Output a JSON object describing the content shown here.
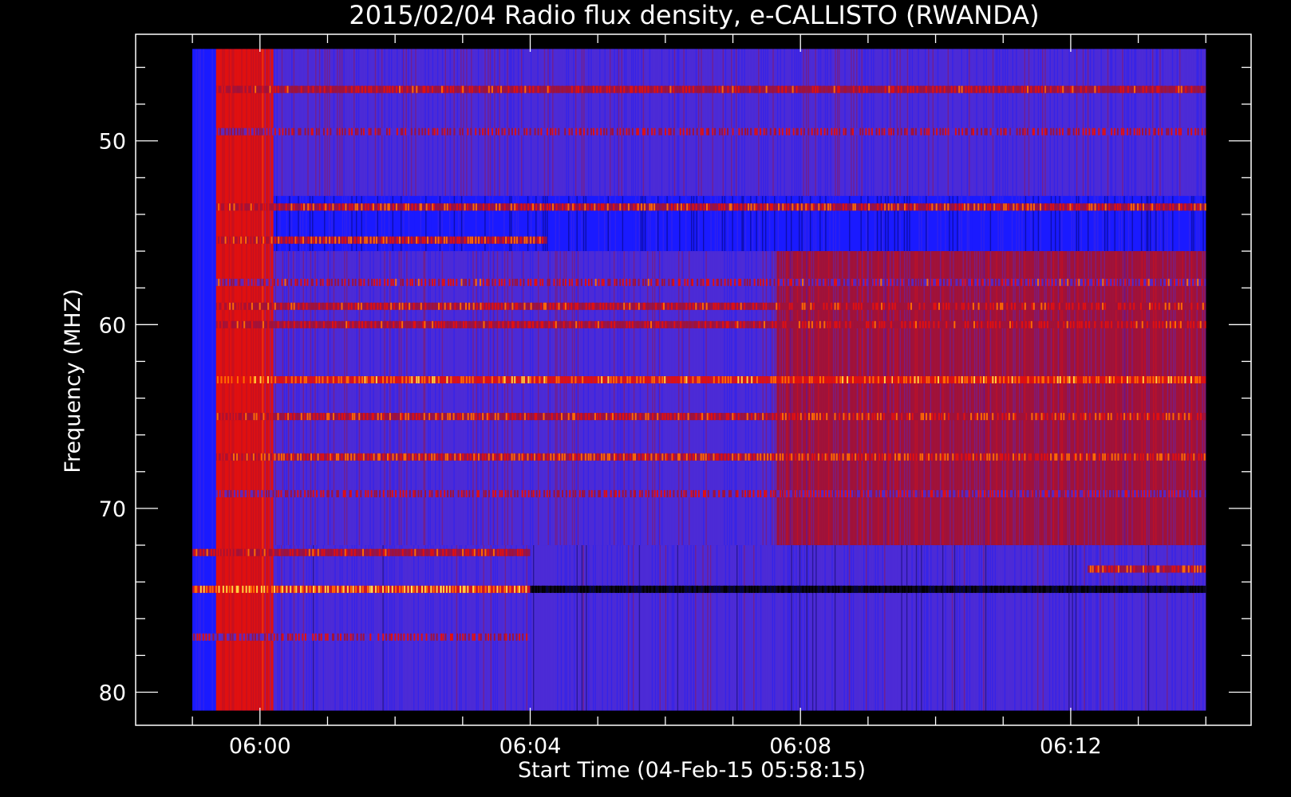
{
  "chart_data": {
    "type": "heatmap",
    "title": "2015/02/04  Radio flux density, e-CALLISTO (RWANDA)",
    "xlabel": "Start Time (04-Feb-15 05:58:15)",
    "ylabel": "Frequency (MHZ)",
    "x_axis": {
      "unit": "minutes since 05:58:15",
      "range": [
        -0.09,
        16.42
      ],
      "data_range": [
        0.75,
        15.75
      ],
      "ticks": [
        {
          "value": 1.75,
          "label": "06:00"
        },
        {
          "value": 5.75,
          "label": "06:04"
        },
        {
          "value": 9.75,
          "label": "06:08"
        },
        {
          "value": 13.75,
          "label": "06:12"
        }
      ]
    },
    "y_axis": {
      "unit": "MHz",
      "range": [
        44.2,
        81.8
      ],
      "data_range": [
        45.0,
        81.0
      ],
      "inverted": true,
      "ticks": [
        {
          "value": 50,
          "label": "50"
        },
        {
          "value": 60,
          "label": "60"
        },
        {
          "value": 70,
          "label": "70"
        },
        {
          "value": 80,
          "label": "80"
        }
      ]
    },
    "colormap": [
      "#000000",
      "#00004a",
      "#1a1aff",
      "#4c2bd6",
      "#a0123a",
      "#e01010",
      "#ff6a00",
      "#ffd040",
      "#ffff60"
    ],
    "regions": [
      {
        "t": [
          0.75,
          1.1
        ],
        "f": [
          45.0,
          81.0
        ],
        "level": 2.3
      },
      {
        "t": [
          1.1,
          1.95
        ],
        "f": [
          45.0,
          81.0
        ],
        "level": 4.6
      },
      {
        "t": [
          1.95,
          15.75
        ],
        "f": [
          45.0,
          53.0
        ],
        "level": 2.8
      },
      {
        "t": [
          1.95,
          15.75
        ],
        "f": [
          53.0,
          56.0
        ],
        "level": 2.1
      },
      {
        "t": [
          1.95,
          15.75
        ],
        "f": [
          56.0,
          72.0
        ],
        "level": 2.9
      },
      {
        "t": [
          1.95,
          15.75
        ],
        "f": [
          72.0,
          81.0
        ],
        "level": 2.5
      },
      {
        "t": [
          9.4,
          15.75
        ],
        "f": [
          56.0,
          72.0
        ],
        "level": 3.6
      }
    ],
    "bands": [
      {
        "f": 47.2,
        "t": [
          1.1,
          15.75
        ],
        "level": 4.5
      },
      {
        "f": 49.5,
        "t": [
          1.1,
          15.75
        ],
        "level": 4.2
      },
      {
        "f": 53.6,
        "t": [
          1.1,
          15.75
        ],
        "level": 5.0
      },
      {
        "f": 55.4,
        "t": [
          1.1,
          6.0
        ],
        "level": 5.3
      },
      {
        "f": 57.7,
        "t": [
          1.1,
          15.75
        ],
        "level": 4.4
      },
      {
        "f": 59.0,
        "t": [
          1.1,
          15.75
        ],
        "level": 4.8
      },
      {
        "f": 60.0,
        "t": [
          1.1,
          15.75
        ],
        "level": 4.6
      },
      {
        "f": 63.0,
        "t": [
          1.1,
          15.75
        ],
        "level": 5.6
      },
      {
        "f": 65.0,
        "t": [
          1.1,
          15.75
        ],
        "level": 5.0
      },
      {
        "f": 67.2,
        "t": [
          1.1,
          15.75
        ],
        "level": 5.3
      },
      {
        "f": 69.2,
        "t": [
          1.1,
          15.75
        ],
        "level": 4.3
      },
      {
        "f": 72.4,
        "t": [
          0.75,
          5.75
        ],
        "level": 4.8
      },
      {
        "f": 73.3,
        "t": [
          14.0,
          15.75
        ],
        "level": 5.0
      },
      {
        "f": 74.4,
        "t": [
          0.75,
          5.75
        ],
        "level": 6.4
      },
      {
        "f": 74.4,
        "t": [
          5.75,
          15.75
        ],
        "level": 0.0
      },
      {
        "f": 77.0,
        "t": [
          0.75,
          5.75
        ],
        "level": 4.2
      }
    ]
  }
}
